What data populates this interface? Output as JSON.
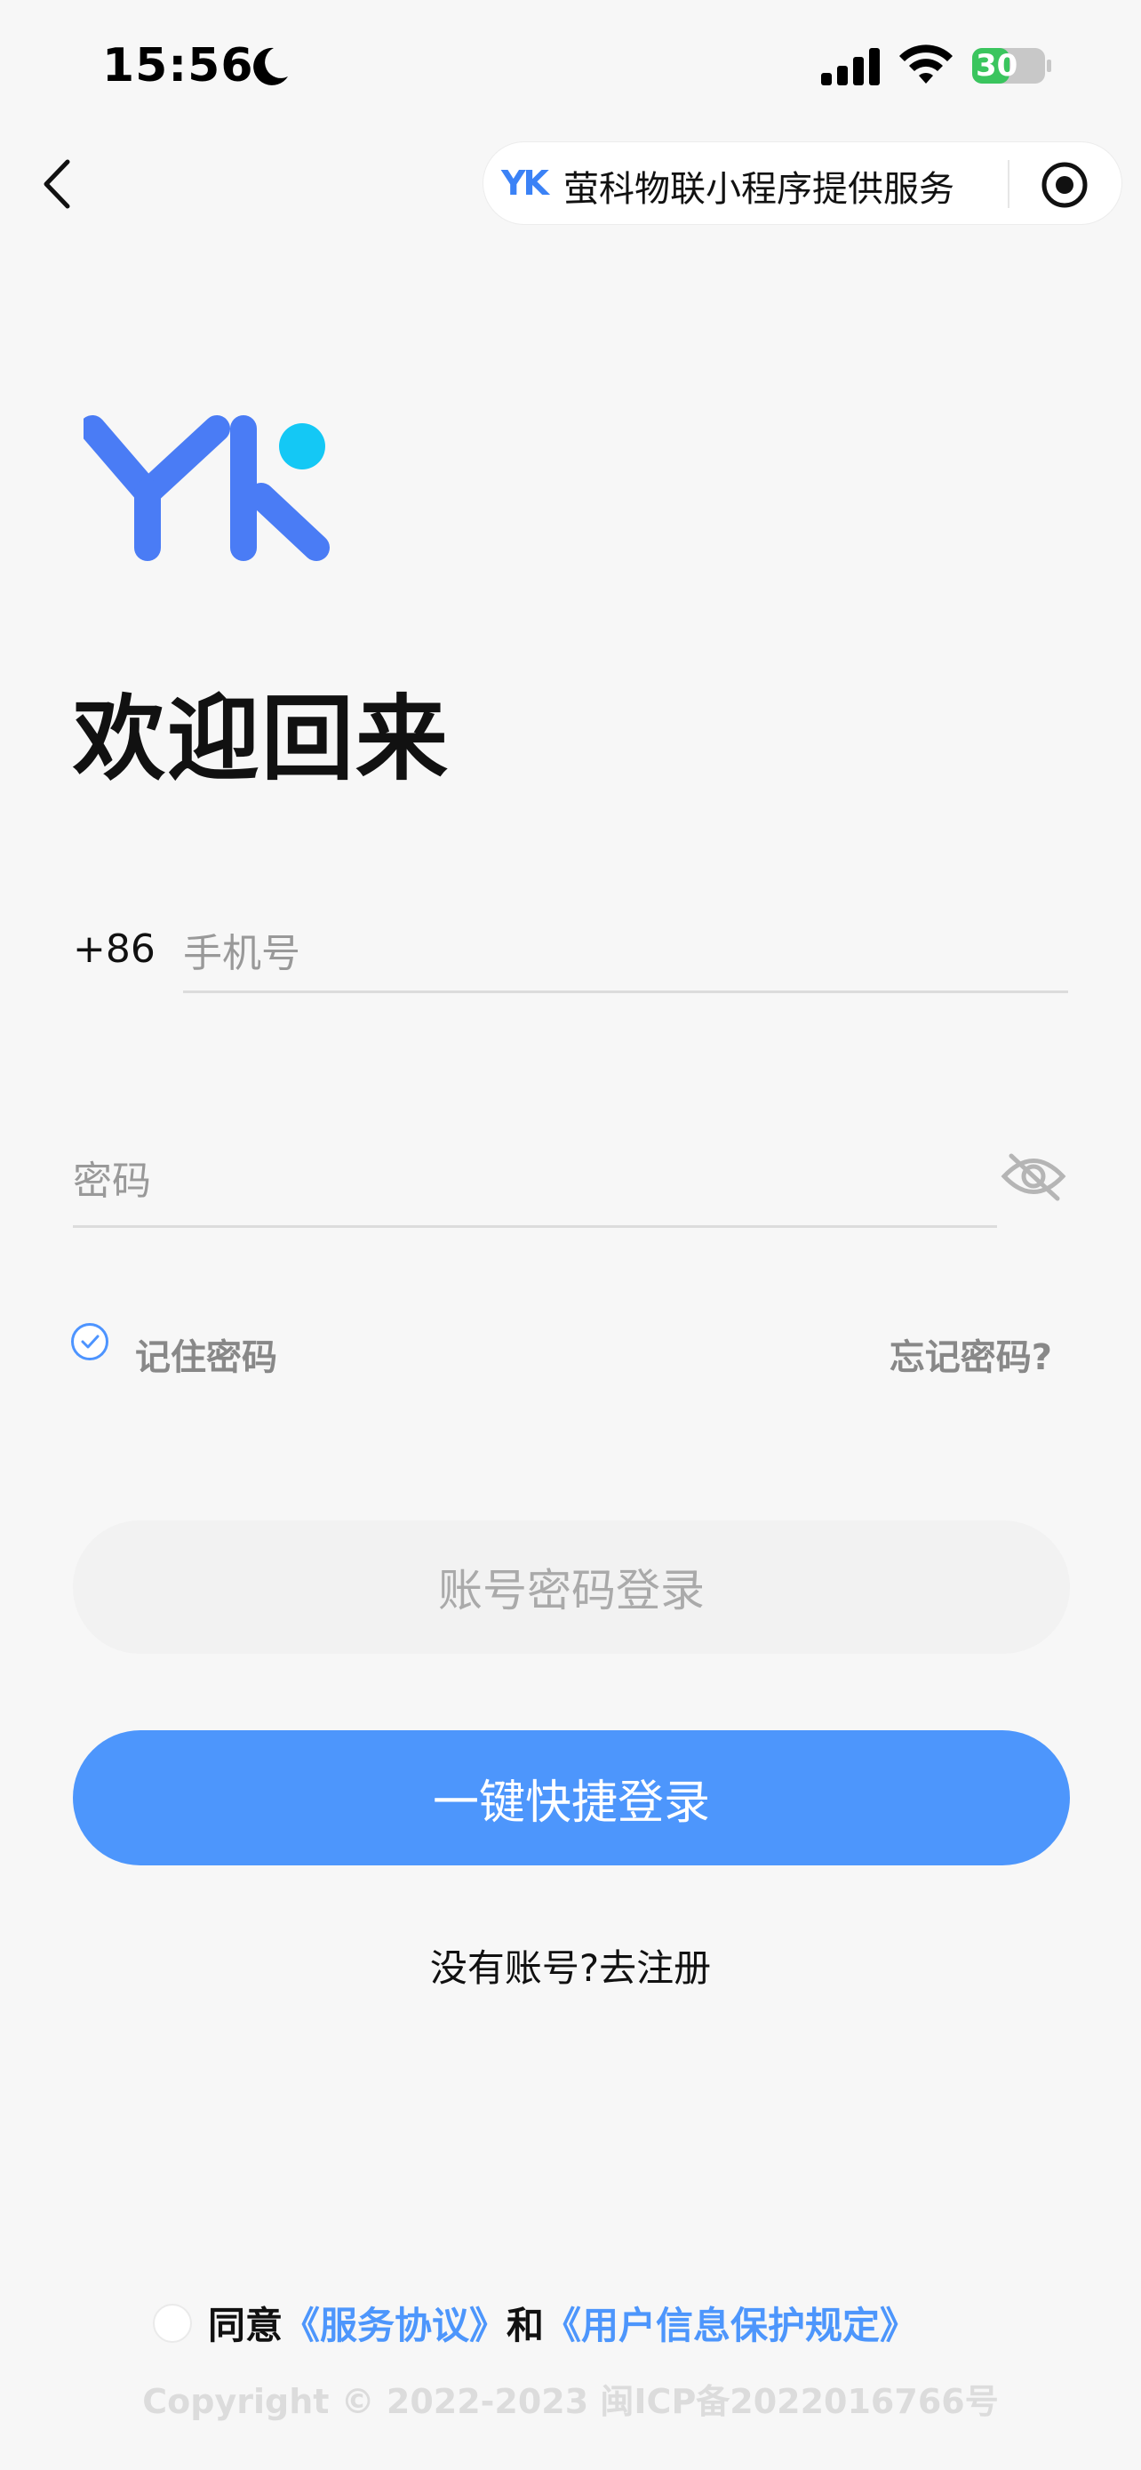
{
  "status_bar": {
    "time": "15:56",
    "battery": "30"
  },
  "nav": {
    "capsule_logo": "YK",
    "capsule_text": "萤科物联小程序提供服务"
  },
  "page": {
    "welcome": "欢迎回来"
  },
  "form": {
    "country_code": "+86",
    "phone_placeholder": "手机号",
    "password_placeholder": "密码",
    "remember_label": "记住密码",
    "forgot_label": "忘记密码?",
    "remember_checked": true
  },
  "actions": {
    "password_login": "账号密码登录",
    "quick_login": "一键快捷登录",
    "register": "没有账号?去注册"
  },
  "agreement": {
    "prefix": "同意",
    "service_link": "《服务协议》",
    "and": "和",
    "privacy_link": "《用户信息保护规定》"
  },
  "footer": {
    "copyright": "Copyright © 2022-2023 闽ICP备2022016766号"
  },
  "colors": {
    "primary": "#4d96fc",
    "logo_blue": "#4a7cf5",
    "logo_cyan": "#14c8f5"
  }
}
